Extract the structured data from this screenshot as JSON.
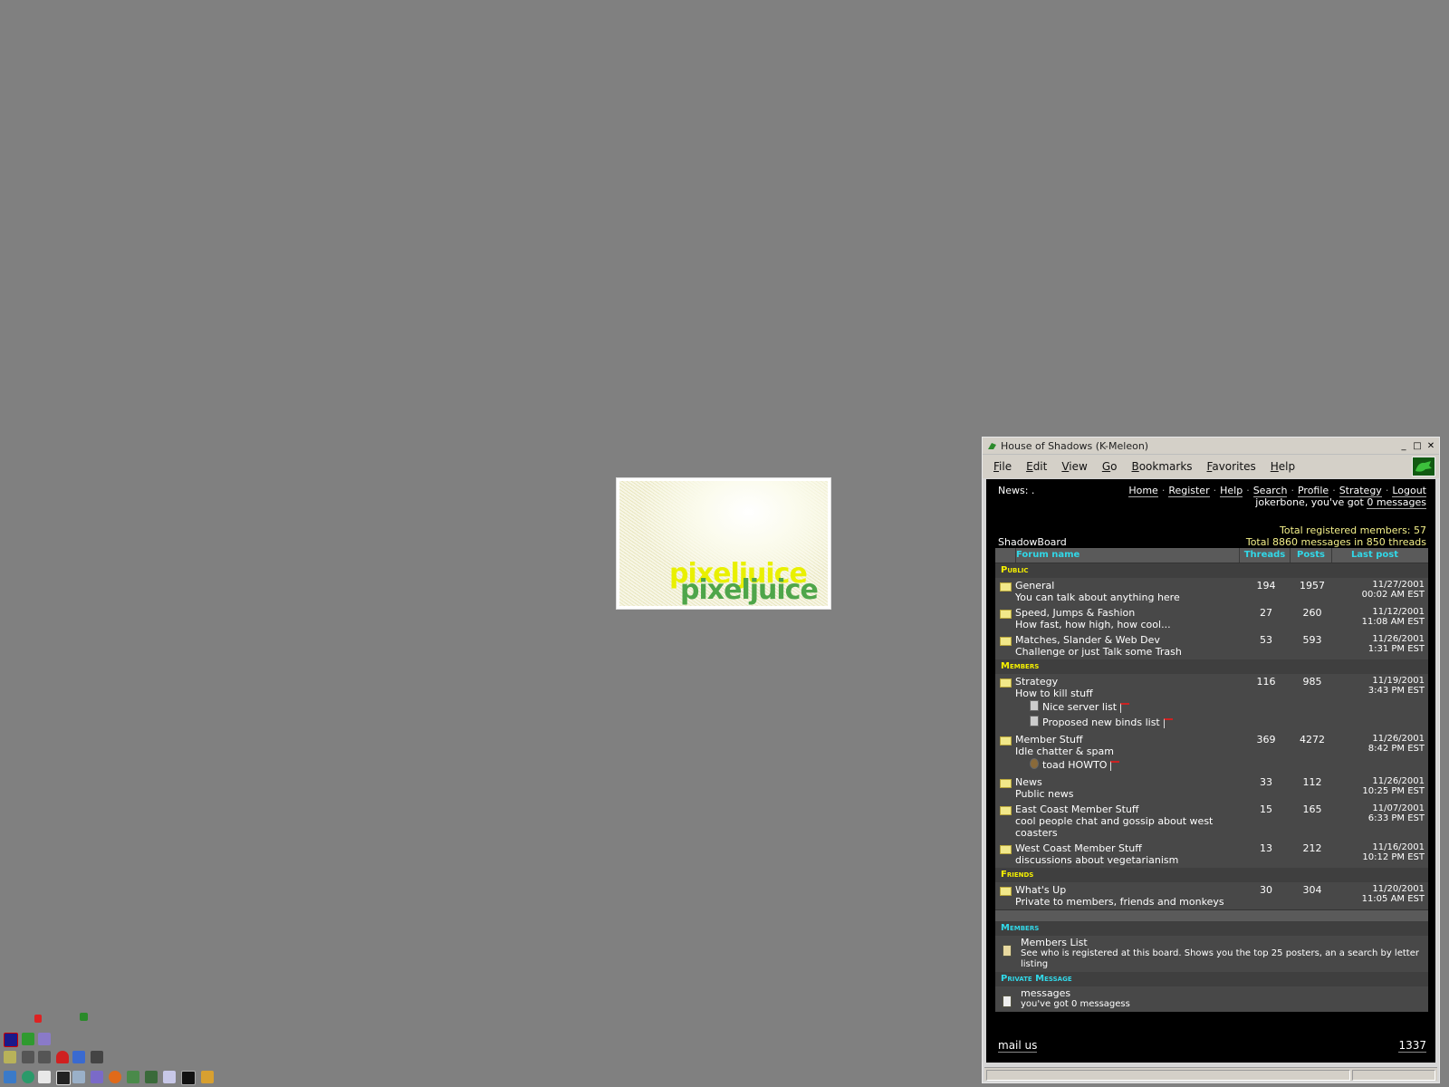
{
  "window": {
    "title": "House of Shadows (K-Meleon)",
    "controls": [
      "_",
      "□",
      "✕"
    ]
  },
  "menu": [
    "File",
    "Edit",
    "View",
    "Go",
    "Bookmarks",
    "Favorites",
    "Help"
  ],
  "page": {
    "news": "News: .",
    "nav": [
      "Home",
      "Register",
      "Help",
      "Search",
      "Profile",
      "Strategy",
      "Logout"
    ],
    "user_prefix": "jokerbone, you've got ",
    "user_link": "0 messages",
    "stats_members": "Total registered members: 57",
    "stats_messages": "Total 8860 messages in 850 threads",
    "board_name": "ShadowBoard"
  },
  "table": {
    "headers": {
      "forum": "Forum name",
      "threads": "Threads",
      "posts": "Posts",
      "last": "Last post"
    },
    "categories": {
      "public": "Public",
      "members": "Members",
      "friends": "Friends"
    },
    "forums": [
      {
        "name": "General",
        "desc": "You can talk about anything here",
        "threads": "194",
        "posts": "1957",
        "date": "11/27/2001",
        "time": "00:02 AM EST"
      },
      {
        "name": "Speed, Jumps & Fashion",
        "desc": "How fast, how high, how cool...",
        "threads": "27",
        "posts": "260",
        "date": "11/12/2001",
        "time": "11:08 AM EST"
      },
      {
        "name": "Matches, Slander & Web Dev",
        "desc": "Challenge or just Talk some Trash",
        "threads": "53",
        "posts": "593",
        "date": "11/26/2001",
        "time": "1:31 PM EST"
      },
      {
        "name": "Strategy",
        "desc": "How to kill stuff",
        "threads": "116",
        "posts": "985",
        "date": "11/19/2001",
        "time": "3:43 PM EST",
        "subs": [
          "Nice server list",
          "Proposed new binds list"
        ]
      },
      {
        "name": "Member Stuff",
        "desc": "Idle chatter & spam",
        "threads": "369",
        "posts": "4272",
        "date": "11/26/2001",
        "time": "8:42 PM EST",
        "subs": [
          "toad HOWTO"
        ]
      },
      {
        "name": "News",
        "desc": "Public news",
        "threads": "33",
        "posts": "112",
        "date": "11/26/2001",
        "time": "10:25 PM EST"
      },
      {
        "name": "East Coast Member Stuff",
        "desc": "cool people chat and gossip about west coasters",
        "threads": "15",
        "posts": "165",
        "date": "11/07/2001",
        "time": "6:33 PM EST"
      },
      {
        "name": "West Coast Member Stuff",
        "desc": "discussions about vegetarianism",
        "threads": "13",
        "posts": "212",
        "date": "11/16/2001",
        "time": "10:12 PM EST"
      },
      {
        "name": "What's Up",
        "desc": "Private to members, friends and monkeys",
        "threads": "30",
        "posts": "304",
        "date": "11/20/2001",
        "time": "11:05 AM EST"
      }
    ]
  },
  "members_box": {
    "heading": "Members",
    "title": "Members List",
    "desc": "See who is registered at this board. Shows you the top 25 posters, an a search by letter listing"
  },
  "pm_box": {
    "heading": "Private Message",
    "title": "messages",
    "desc": "you've got 0 messagess"
  },
  "footer": {
    "mail": "mail us",
    "counter": "1337"
  },
  "desktop_image": {
    "logo_text": "pixeljuice"
  },
  "colors": {
    "desktop": "#808080",
    "accent_cyan": "#31d8e8",
    "accent_yellow": "#f5f000"
  }
}
